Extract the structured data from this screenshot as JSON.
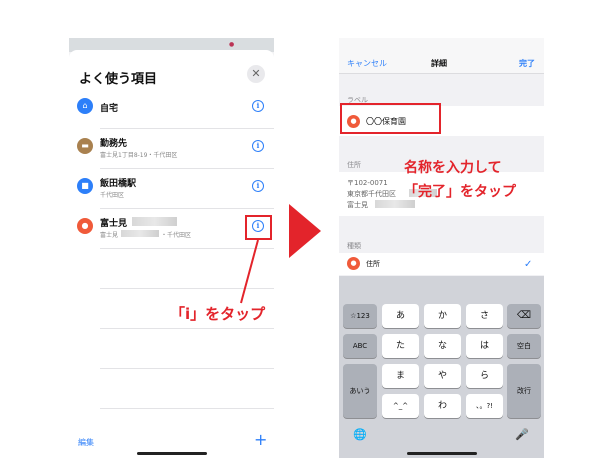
{
  "left_screen": {
    "title": "よく使う項目",
    "close_symbol": "✕",
    "favorites": [
      {
        "name": "自宅",
        "subtitle": "",
        "icon": "home-icon",
        "color": "#2d7ff9",
        "glyph": "⌂"
      },
      {
        "name": "勤務先",
        "subtitle": "富士見1丁目8-19・千代田区",
        "icon": "briefcase-icon",
        "color": "#a9814f",
        "glyph": "▬"
      },
      {
        "name": "飯田橋駅",
        "subtitle": "千代田区",
        "icon": "train-icon",
        "color": "#2d7ff9",
        "glyph": "■"
      },
      {
        "name": "富士見",
        "subtitle": "富士見",
        "subtitle_end": "・千代田区",
        "icon": "pin-icon",
        "color": "#f05a3a",
        "glyph": "●"
      }
    ],
    "info_glyph": "i",
    "edit_label": "編集",
    "add_symbol": "+",
    "callout": "「i」をタップ"
  },
  "right_screen": {
    "nav": {
      "cancel": "キャンセル",
      "title": "詳細",
      "done": "完了"
    },
    "label_section": "ラベル",
    "label_value": "〇〇保育園",
    "address_section": "住所",
    "address_lines": [
      "〒102-0071",
      "東京都千代田区",
      "富士見"
    ],
    "type_section": "種類",
    "type_value": "住所",
    "check_symbol": "✓",
    "callout_line1": "名称を入力して",
    "callout_line2": "「完了」をタップ",
    "keyboard": {
      "row1": [
        "☆123",
        "あ",
        "か",
        "さ",
        "⌫"
      ],
      "row2": [
        "ABC",
        "た",
        "な",
        "は",
        "空白"
      ],
      "row3": [
        "あいう",
        "ま",
        "や",
        "ら",
        "改行"
      ],
      "row4": [
        "^_^",
        "わ",
        "、。?!"
      ],
      "globe": "🌐",
      "mic": "🎤"
    }
  },
  "colors": {
    "accent_red": "#e3242b",
    "ios_blue": "#2d7ff9"
  }
}
